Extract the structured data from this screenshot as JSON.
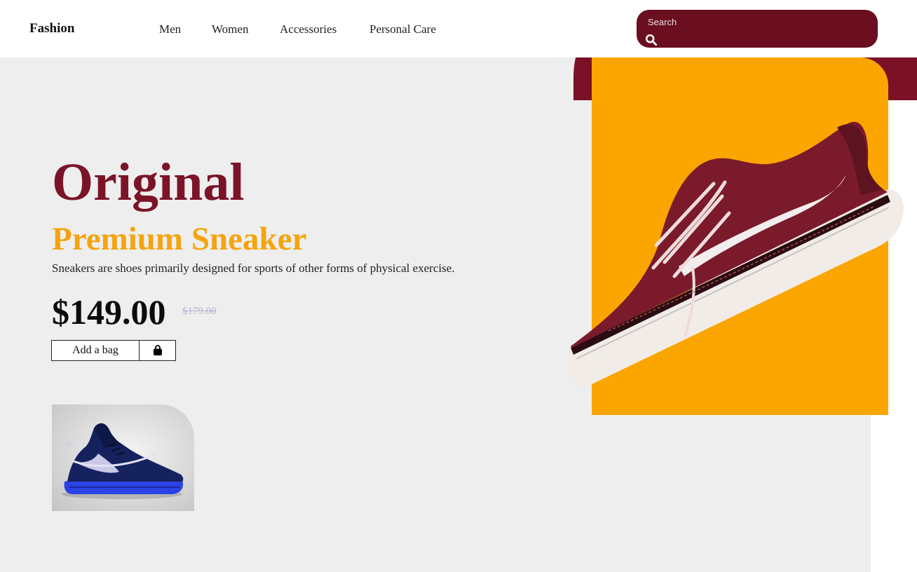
{
  "header": {
    "brand": "Fashion",
    "nav": [
      {
        "label": "Men"
      },
      {
        "label": "Women"
      },
      {
        "label": "Accessories"
      },
      {
        "label": "Personal Care"
      }
    ],
    "search": {
      "label": "Search",
      "icon": "search-icon"
    },
    "cart": {
      "icon": "cart-menu-icon"
    }
  },
  "hero": {
    "title": "Original",
    "subtitle": "Premium Sneaker",
    "description": "Sneakers are shoes primarily designed for sports of other forms of physical exercise.",
    "price": "$149.00",
    "old_price": "$179.00",
    "add_button_label": "Add a bag",
    "bag_icon": "shopping-bag-icon",
    "image": "maroon-sneaker-image"
  },
  "thumbnail": {
    "image": "blue-sneaker-image"
  },
  "colors": {
    "maroon": "#7b1126",
    "title_maroon": "#7b1428",
    "orange": "#fba500",
    "subtitle_orange": "#f5a40e",
    "hero_bg": "#eeeeee"
  }
}
